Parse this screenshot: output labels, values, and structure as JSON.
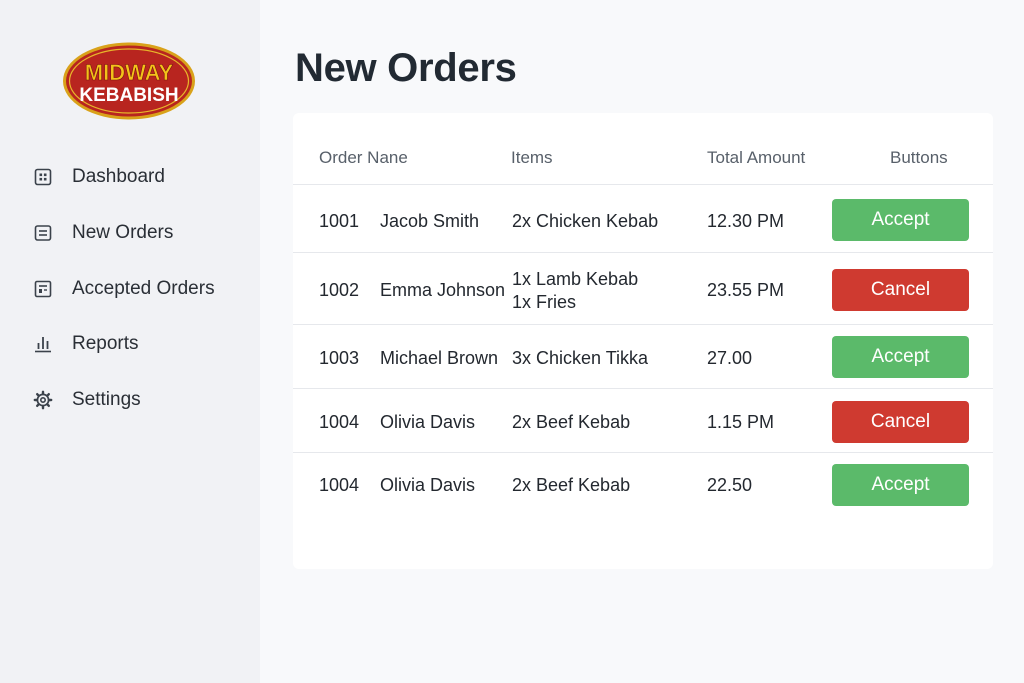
{
  "brand": {
    "logo_line1": "MIDWAY",
    "logo_line2": "KEBABISH",
    "colors": {
      "red": "#b8251f",
      "gold": "#f3c21a",
      "outline": "#d9a21a"
    }
  },
  "sidebar": {
    "items": [
      {
        "label": "Dashboard",
        "icon": "dashboard-icon"
      },
      {
        "label": "New Orders",
        "icon": "orders-list-icon"
      },
      {
        "label": "Accepted Orders",
        "icon": "receipt-icon"
      },
      {
        "label": "Reports",
        "icon": "bar-chart-icon"
      },
      {
        "label": "Settings",
        "icon": "gear-icon"
      }
    ]
  },
  "main": {
    "title": "New Orders",
    "table": {
      "headers": {
        "order_name": "Order Nane",
        "items": "Items",
        "total": "Total Amount",
        "buttons": "Buttons"
      },
      "rows": [
        {
          "id": "1001",
          "name": "Jacob Smith",
          "items": [
            "2x Chicken Kebab"
          ],
          "total": "12.30 PM",
          "action": "Accept",
          "action_type": "accept"
        },
        {
          "id": "1002",
          "name": "Emma Johnson",
          "items": [
            "1x Lamb Kebab",
            "1x Fries"
          ],
          "total": "23.55 PM",
          "action": "Cancel",
          "action_type": "cancel"
        },
        {
          "id": "1003",
          "name": "Michael Brown",
          "items": [
            "3x Chicken Tikka"
          ],
          "total": "27.00",
          "action": "Accept",
          "action_type": "accept"
        },
        {
          "id": "1004",
          "name": "Olivia Davis",
          "items": [
            "2x Beef Kebab"
          ],
          "total": "1.15 PM",
          "action": "Cancel",
          "action_type": "cancel"
        },
        {
          "id": "1004",
          "name": "Olivia Davis",
          "items": [
            "2x Beef Kebab"
          ],
          "total": "22.50",
          "action": "Accept",
          "action_type": "accept"
        }
      ]
    },
    "colors": {
      "accept": "#5bba6a",
      "cancel": "#cf3a30"
    }
  }
}
